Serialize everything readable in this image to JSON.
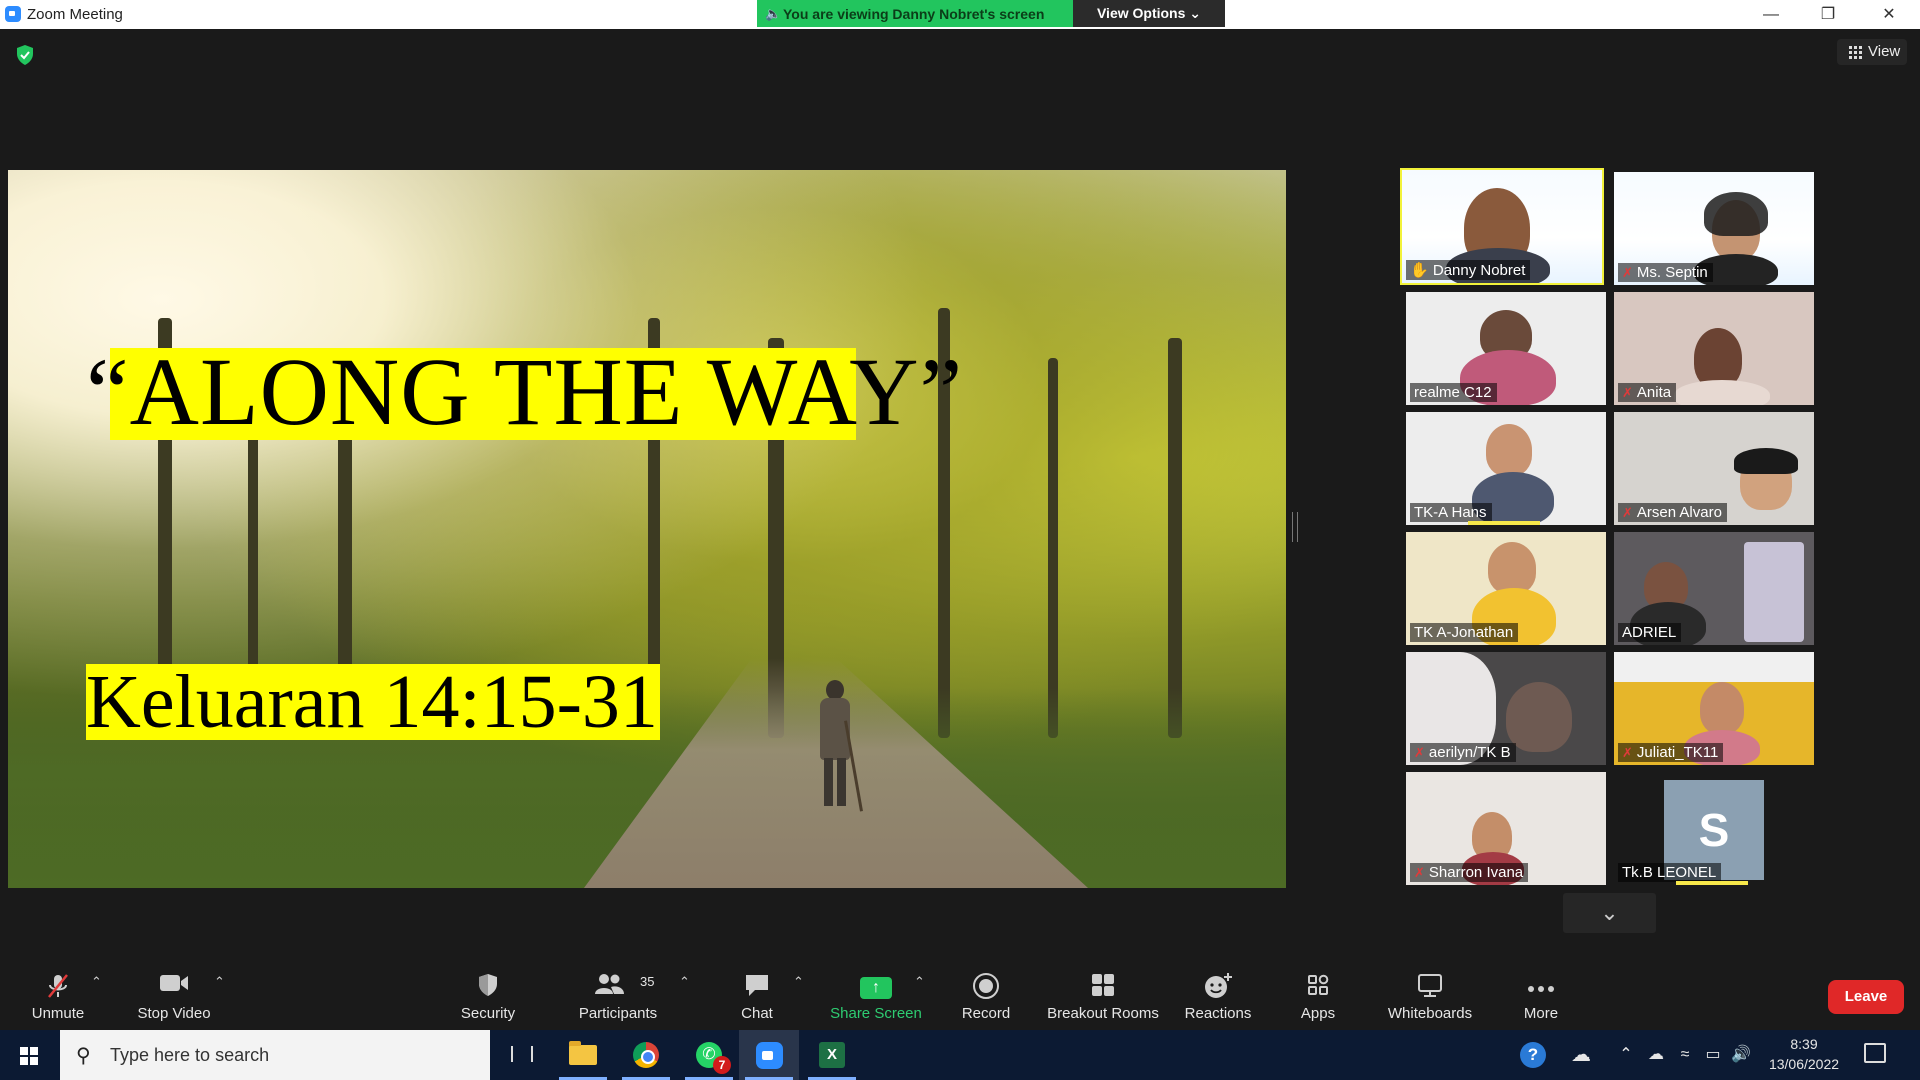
{
  "window": {
    "title": "Zoom Meeting",
    "viewing_banner": "You are viewing Danny Nobret's screen",
    "view_options": "View Options",
    "view_button": "View"
  },
  "shared_screen": {
    "title": "“ALONG THE WAY”",
    "subtitle": "Keluaran 14:15-31"
  },
  "participants": [
    {
      "name": "Danny Nobret",
      "muted": false
    },
    {
      "name": "Ms. Septin",
      "muted": true
    },
    {
      "name": "realme C12",
      "muted": false
    },
    {
      "name": "Anita",
      "muted": true
    },
    {
      "name": "TK-A Hans",
      "muted": false
    },
    {
      "name": "Arsen Alvaro",
      "muted": true
    },
    {
      "name": "TK A-Jonathan",
      "muted": false
    },
    {
      "name": "ADRIEL",
      "muted": false
    },
    {
      "name": "aerilyn/TK B",
      "muted": true
    },
    {
      "name": "Juliati_TK11",
      "muted": true
    },
    {
      "name": "Sharron Ivana",
      "muted": true
    },
    {
      "name": "Tk.B LEONEL",
      "muted": false,
      "avatar_letter": "S"
    }
  ],
  "toolbar": {
    "unmute": "Unmute",
    "stop_video": "Stop Video",
    "security": "Security",
    "participants": "Participants",
    "participants_count": "35",
    "chat": "Chat",
    "share_screen": "Share Screen",
    "record": "Record",
    "breakout_rooms": "Breakout Rooms",
    "reactions": "Reactions",
    "apps": "Apps",
    "whiteboards": "Whiteboards",
    "more": "More",
    "leave": "Leave"
  },
  "taskbar": {
    "search_placeholder": "Type here to search",
    "whatsapp_badge": "7",
    "time": "8:39",
    "date": "13/06/2022"
  },
  "colors": {
    "accent_green": "#22c55e",
    "leave_red": "#e02828",
    "highlight_yellow": "#ffff00"
  }
}
